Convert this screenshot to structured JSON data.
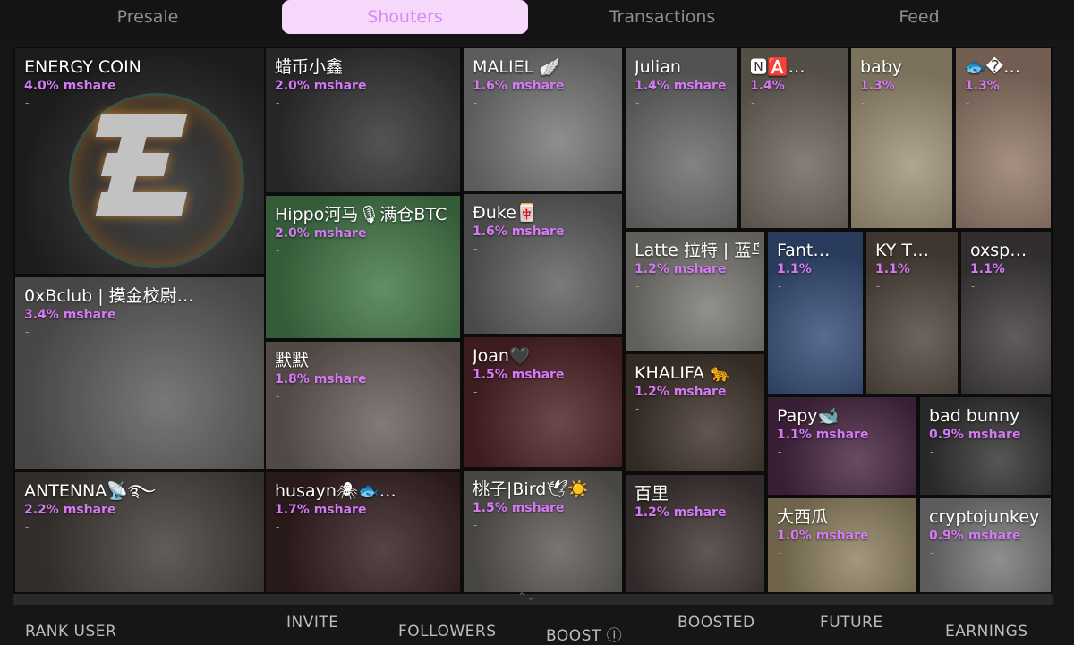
{
  "tabs": [
    {
      "label": "Presale",
      "active": false
    },
    {
      "label": "Shouters",
      "active": true
    },
    {
      "label": "Transactions",
      "active": false
    },
    {
      "label": "Feed",
      "active": false
    }
  ],
  "accent_color": "#d57af5",
  "tiles": [
    {
      "name": "ENERGY COIN",
      "share": "4.0% mshare",
      "dash": "-",
      "bg": "#2a2a2a"
    },
    {
      "name": "蜡币小鑫",
      "share": "2.0% mshare",
      "dash": "-",
      "bg": "#3a3a3a"
    },
    {
      "name": "MALIEL 🪽",
      "share": "1.6% mshare",
      "dash": "-",
      "bg": "#8a8a8a"
    },
    {
      "name": "Julian",
      "share": "1.4% mshare",
      "dash": "-",
      "bg": "#7a7a78"
    },
    {
      "name": "🅽🅰️…",
      "share": "1.4%",
      "dash": "-",
      "bg": "#7d756a"
    },
    {
      "name": "baby",
      "share": "1.3%",
      "dash": "-",
      "bg": "#b8a98a"
    },
    {
      "name": "🐟�…",
      "share": "1.3%",
      "dash": "-",
      "bg": "#a98c7a"
    },
    {
      "name": "Hippo河马🎙满仓BTC",
      "share": "2.0% mshare",
      "dash": "-",
      "bg": "#4e8a54"
    },
    {
      "name": "Đuke🀄️",
      "share": "1.6% mshare",
      "dash": "-",
      "bg": "#6f6f6f"
    },
    {
      "name": "Latte 拉特 | 蓝鸟会",
      "share": "1.2% mshare",
      "dash": "-",
      "bg": "#8f8d88"
    },
    {
      "name": "Fant…",
      "share": "1.1%",
      "dash": "-",
      "bg": "#3f5a8a"
    },
    {
      "name": "KY T…",
      "share": "1.1%",
      "dash": "-",
      "bg": "#5d5247"
    },
    {
      "name": "oxsp…",
      "share": "1.1%",
      "dash": "-",
      "bg": "#4a4548"
    },
    {
      "name": "0xBclub | 摸金校尉…",
      "share": "3.4% mshare",
      "dash": "-",
      "bg": "#6d6b6a"
    },
    {
      "name": "默默",
      "share": "1.8% mshare",
      "dash": "-",
      "bg": "#7b6d6a"
    },
    {
      "name": "Joan🖤",
      "share": "1.5% mshare",
      "dash": "-",
      "bg": "#5a2a2e"
    },
    {
      "name": "KHALIFA 🐆",
      "share": "1.2% mshare",
      "dash": "-",
      "bg": "#4c3e35"
    },
    {
      "name": "Papy🐋",
      "share": "1.1% mshare",
      "dash": "-",
      "bg": "#552f4f"
    },
    {
      "name": "bad bunny",
      "share": "0.9% mshare",
      "dash": "-",
      "bg": "#3d3d3d"
    },
    {
      "name": "ANTENNA📡࿐",
      "share": "2.2% mshare",
      "dash": "-",
      "bg": "#4c4640"
    },
    {
      "name": "husayn🕷🐟…",
      "share": "1.7% mshare",
      "dash": "-",
      "bg": "#3d2628"
    },
    {
      "name": "桃子|Bird🕊☀️",
      "share": "1.5% mshare",
      "dash": "-",
      "bg": "#6b6864"
    },
    {
      "name": "百里",
      "share": "1.2% mshare",
      "dash": "-",
      "bg": "#4a3f3e"
    },
    {
      "name": "大西瓜",
      "share": "1.0% mshare",
      "dash": "-",
      "bg": "#a59670"
    },
    {
      "name": "cryptojunkey …",
      "share": "0.9% mshare",
      "dash": "-",
      "bg": "#8b8b8b"
    }
  ],
  "table_headers": {
    "rank_user": "RANK   USER",
    "invite": "INVITE",
    "followers": "FOLLOWERS",
    "boost": "BOOST ⓘ",
    "boosted": "BOOSTED",
    "future": "FUTURE",
    "earnings": "EARNINGS"
  }
}
